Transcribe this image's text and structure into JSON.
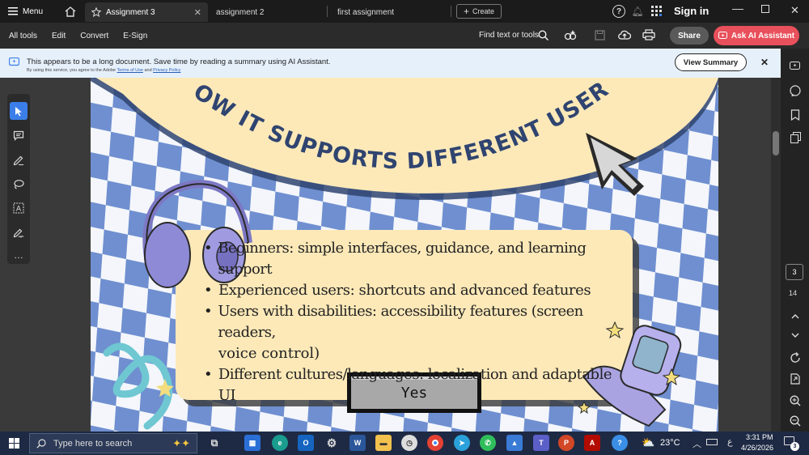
{
  "titlebar": {
    "menu_label": "Menu",
    "tabs": [
      {
        "label": "Assignment 3",
        "active": true
      },
      {
        "label": "assignment 2",
        "active": false
      },
      {
        "label": "first assignment",
        "active": false
      }
    ],
    "create_label": "Create",
    "signin_label": "Sign in"
  },
  "toolbar": {
    "menus": [
      "All tools",
      "Edit",
      "Convert",
      "E-Sign"
    ],
    "find_label": "Find text or tools",
    "share_label": "Share",
    "ai_label": "Ask AI Assistant"
  },
  "banner": {
    "message": "This appears to be a long document. Save time by reading a summary using AI Assistant.",
    "sub_prefix": "By using this service, you agree to the Adobe",
    "terms_label": "Terms of Use",
    "and_label": "and",
    "privacy_label": "Privacy Policy",
    "view_summary_label": "View Summary"
  },
  "slide": {
    "title": "HOW IT SUPPORTS DIFFERENT USERS:",
    "bullets": [
      "Beginners: simple interfaces, guidance, and learning support",
      "Experienced users: shortcuts and advanced features",
      "Users with disabilities: accessibility features (screen readers,",
      "voice control)",
      "Different cultures/languages: localization and adaptable UI"
    ],
    "button_label": "Yes",
    "colors": {
      "checker_blue": "#6f8fd0",
      "cream": "#fde9b8",
      "title": "#2f4470"
    }
  },
  "pages": {
    "current": "3",
    "total": "14"
  },
  "taskbar": {
    "search_placeholder": "Type here to search",
    "weather": "23°C",
    "time": "3:31 PM",
    "date": "4/26/2026",
    "notification_count": "3",
    "lang": "ع"
  }
}
